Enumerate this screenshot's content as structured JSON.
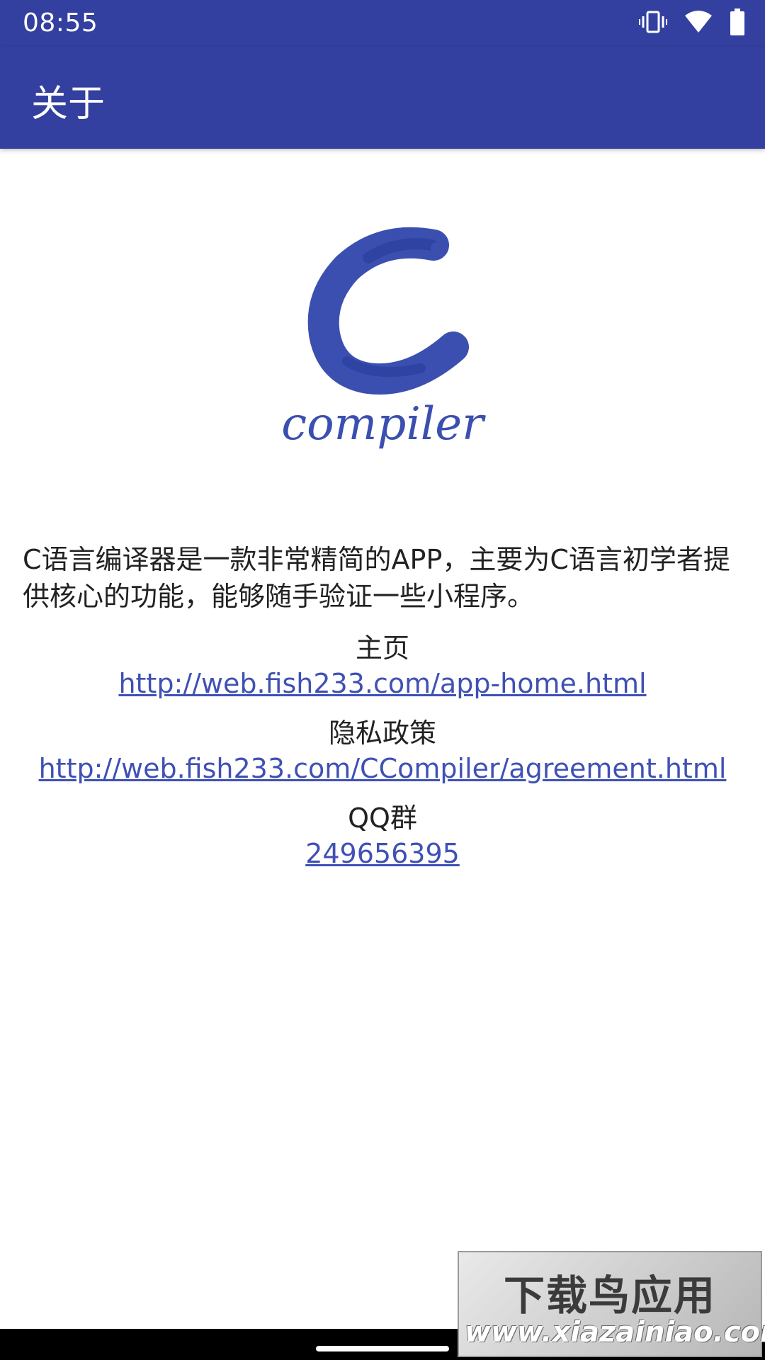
{
  "status": {
    "time": "08:55",
    "icons": [
      "vibrate-icon",
      "wifi-icon",
      "battery-icon"
    ]
  },
  "app_bar": {
    "title": "关于"
  },
  "logo": {
    "text": "compiler",
    "letter": "C"
  },
  "content": {
    "description": "C语言编译器是一款非常精简的APP，主要为C语言初学者提供核心的功能，能够随手验证一些小程序。",
    "homepage_label": "主页",
    "homepage_url": "http://web.fish233.com/app-home.html",
    "privacy_label": "隐私政策",
    "privacy_url": "http://web.fish233.com/CCompiler/agreement.html",
    "qq_label": "QQ群",
    "qq_number": "249656395"
  },
  "watermark": {
    "title": "下载鸟应用",
    "url": "www.xiazainiao.com"
  },
  "colors": {
    "primary": "#3340a0",
    "link": "#3f51b5",
    "logo": "#3a4fb0"
  }
}
